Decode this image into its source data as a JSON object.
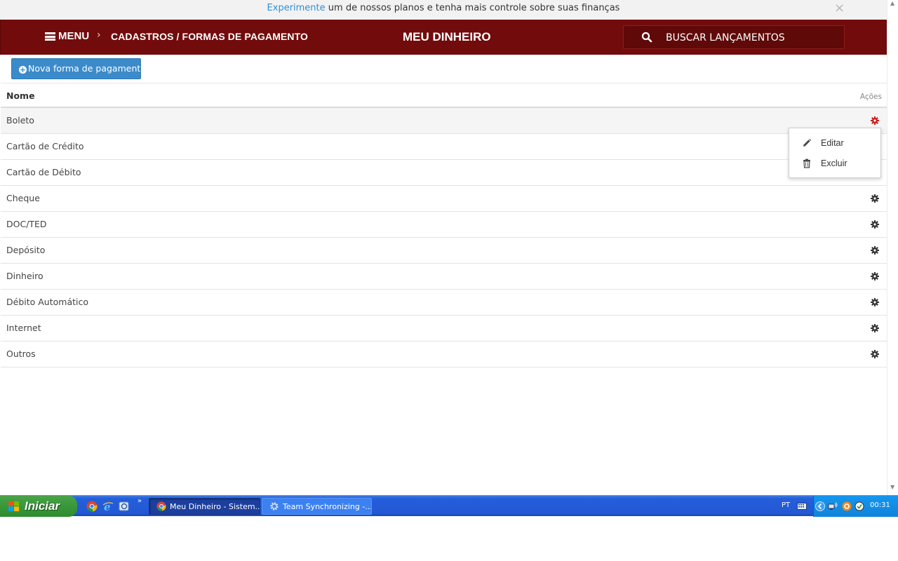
{
  "promo": {
    "link_text": "Experimente",
    "text": " um de nossos planos e tenha mais controle sobre suas finanças",
    "close_glyph": "×"
  },
  "header": {
    "menu_label": "MENU",
    "separator": "›",
    "breadcrumb": "CADASTROS / FORMAS DE PAGAMENTO",
    "app_title": "MEU DINHEIRO",
    "search_placeholder": "BUSCAR LANÇAMENTOS",
    "search_icon": "search-icon",
    "brand_color": "#720b0b"
  },
  "toolbar": {
    "new_button_label": "Nova forma de pagamento",
    "new_button_icon": "plus-circle-icon",
    "button_color": "#3b8bcb"
  },
  "table": {
    "columns": [
      "Nome",
      "Ações"
    ],
    "rows": [
      {
        "name": "Boleto",
        "selected": true
      },
      {
        "name": "Cartão de Crédito"
      },
      {
        "name": "Cartão de Débito"
      },
      {
        "name": "Cheque"
      },
      {
        "name": "DOC/TED"
      },
      {
        "name": "Depósito"
      },
      {
        "name": "Dinheiro"
      },
      {
        "name": "Débito Automático"
      },
      {
        "name": "Internet"
      },
      {
        "name": "Outros"
      }
    ],
    "active_gear_color": "#cc1b1b",
    "gear_color": "#333333"
  },
  "dropdown": {
    "items": [
      {
        "label": "Editar",
        "icon": "pencil-icon"
      },
      {
        "label": "Excluir",
        "icon": "trash-icon"
      }
    ]
  },
  "taskbar": {
    "start_label": "Iniciar",
    "more_glyph": "»",
    "tasks": [
      {
        "label": "Meu Dinheiro - Sistem...",
        "icon": "chrome-icon",
        "active": true
      },
      {
        "label": "Team Synchronizing -...",
        "icon": "gear-icon",
        "active": false
      }
    ],
    "language": "PT",
    "clock": "00:31"
  }
}
